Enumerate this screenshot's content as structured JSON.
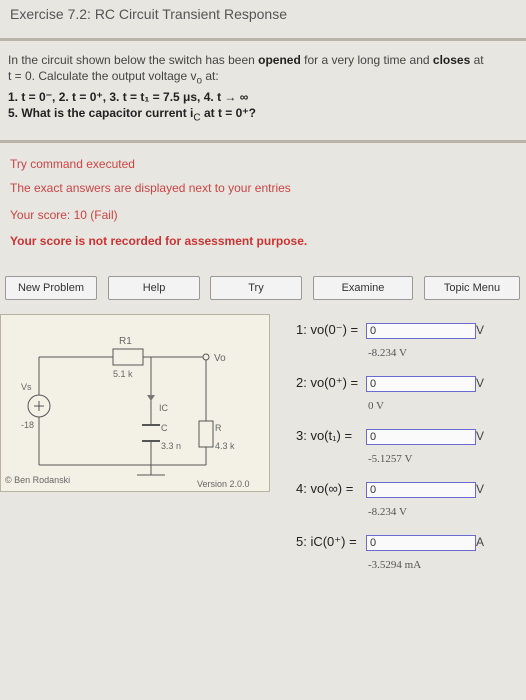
{
  "header": {
    "title": "Exercise 7.2: RC Circuit Transient Response"
  },
  "problem": {
    "text_a": "In the circuit shown below the switch has been ",
    "opened": "opened",
    "text_b": " for a very long time and ",
    "closes": "closes",
    "text_c": " at",
    "line2": "t = 0. Calculate the output voltage v",
    "line2_sub": "o",
    "line2_end": " at:",
    "items": "1. t = 0⁻, 2. t = 0⁺, 3. t = t₁ = 7.5 μs, 4. t → ∞",
    "q5": "5. What is the capacitor current i",
    "q5_sub": "C",
    "q5_end": " at t = 0⁺?"
  },
  "feedback": {
    "line1": "Try command executed",
    "line2": "The exact answers are displayed next to your entries",
    "line3": "Your score: 10 (Fail)",
    "line4": "Your score is not recorded for assessment purpose."
  },
  "buttons": {
    "new_problem": "New Problem",
    "help": "Help",
    "try": "Try",
    "examine": "Examine",
    "topic_menu": "Topic Menu"
  },
  "circuit": {
    "r1": "R1",
    "r1_value": "5.1 k",
    "vo": "Vo",
    "vs": "Vs",
    "vs_value": "-18",
    "ic": "IC",
    "c": "C",
    "c_value": "3.3 n",
    "r": "R",
    "r_value": "4.3 k",
    "credit": "© Ben Rodanski",
    "version": "Version 2.0.0"
  },
  "answers": [
    {
      "label": "1: vo(0⁻) =",
      "value": "0",
      "unit": "V",
      "exact": "-8.234 V"
    },
    {
      "label": "2: vo(0⁺) =",
      "value": "0",
      "unit": "V",
      "exact": "0 V"
    },
    {
      "label": "3: vo(t₁) =",
      "value": "0",
      "unit": "V",
      "exact": "-5.1257 V"
    },
    {
      "label": "4: vo(∞) =",
      "value": "0",
      "unit": "V",
      "exact": "-8.234 V"
    },
    {
      "label": "5: iC(0⁺) =",
      "value": "0",
      "unit": "A",
      "exact": "-3.5294 mA"
    }
  ]
}
